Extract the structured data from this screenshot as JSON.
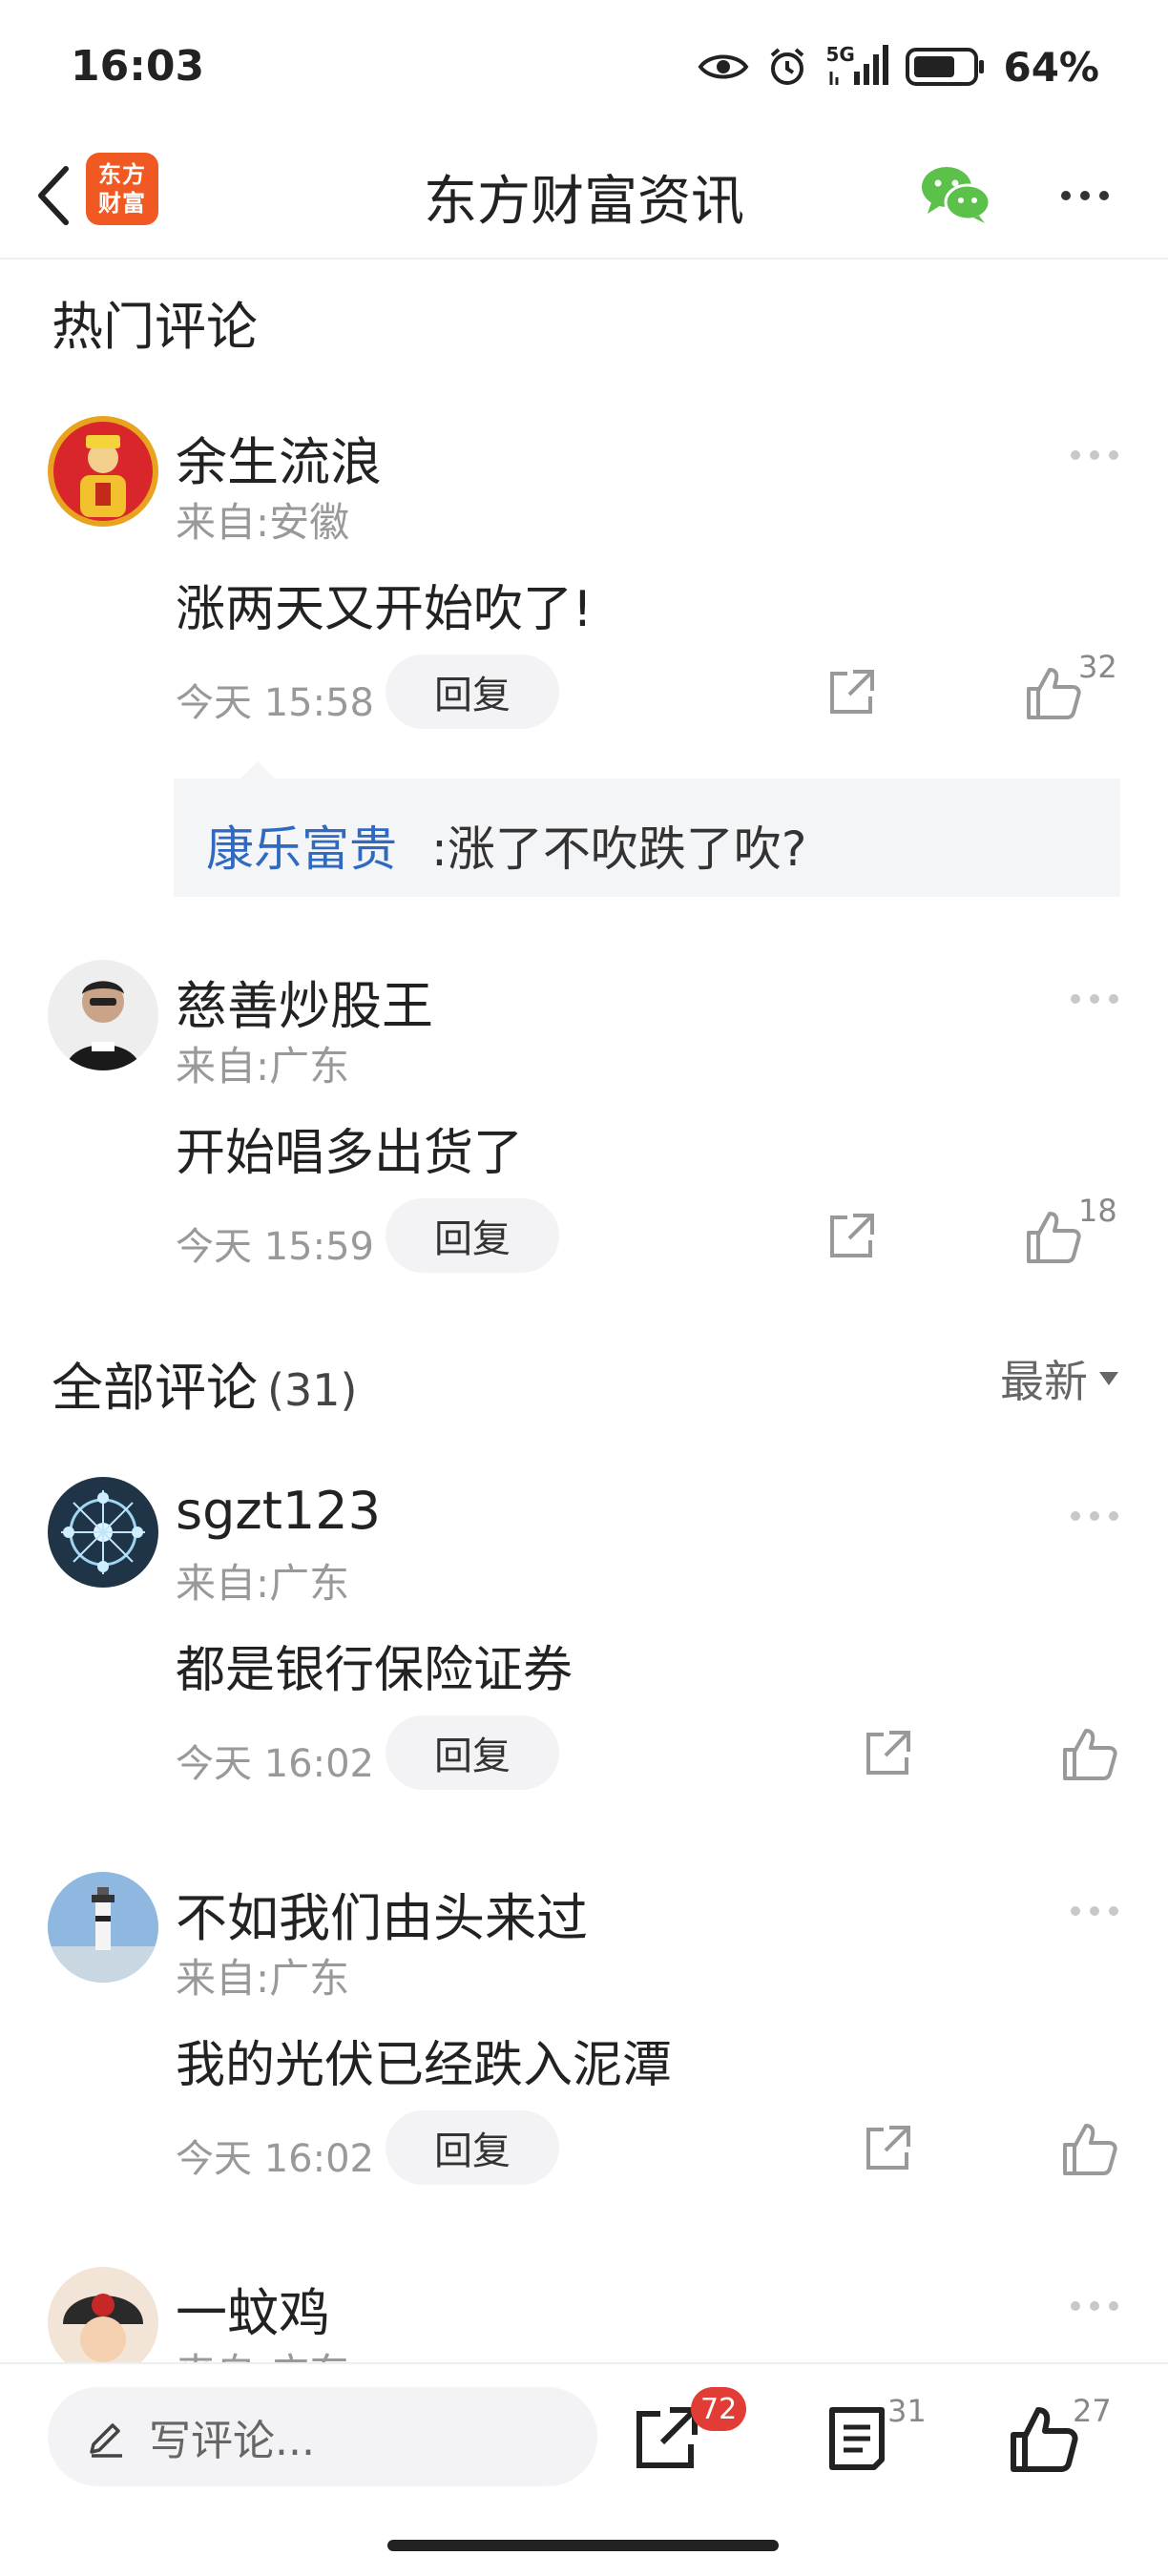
{
  "status_bar": {
    "time": "16:03",
    "network": "5G",
    "battery": "64%",
    "icons": [
      "eye-icon",
      "alarm-icon",
      "signal-icon",
      "battery-icon"
    ]
  },
  "header": {
    "logo_line1": "东方",
    "logo_line2": "财富",
    "title": "东方财富资讯",
    "icons": [
      "back-icon",
      "wechat-icon",
      "more-icon"
    ]
  },
  "hot_section": {
    "title": "热门评论"
  },
  "hot_comments": [
    {
      "name": "余生流浪",
      "from": "来自:安徽",
      "text": "涨两天又开始吹了!",
      "time": "今天 15:58",
      "reply_label": "回复",
      "likes": "32",
      "sub_reply": {
        "name": "康乐富贵",
        "text": ":涨了不吹跌了吹?"
      }
    },
    {
      "name": "慈善炒股王",
      "from": "来自:广东",
      "text": "开始唱多出货了",
      "time": "今天 15:59",
      "reply_label": "回复",
      "likes": "18"
    }
  ],
  "all_section": {
    "title": "全部评论",
    "count": "(31)",
    "sort_label": "最新"
  },
  "all_comments": [
    {
      "name": "sgzt123",
      "from": "来自:广东",
      "text": "都是银行保险证券",
      "time": "今天 16:02",
      "reply_label": "回复"
    },
    {
      "name": "不如我们由头来过",
      "from": "来自:广东",
      "text": "我的光伏已经跌入泥潭",
      "time": "今天 16:02",
      "reply_label": "回复"
    },
    {
      "name": "一蚊鸡",
      "from": "来自:广东"
    }
  ],
  "bottom_bar": {
    "write_placeholder": "写评论...",
    "share_count": "72",
    "comment_count": "31",
    "like_count": "27"
  },
  "colors": {
    "brand_orange": "#f05a22",
    "link_blue": "#2f69c0",
    "badge_red": "#e23c36",
    "wechat_green": "#5cc14a"
  }
}
